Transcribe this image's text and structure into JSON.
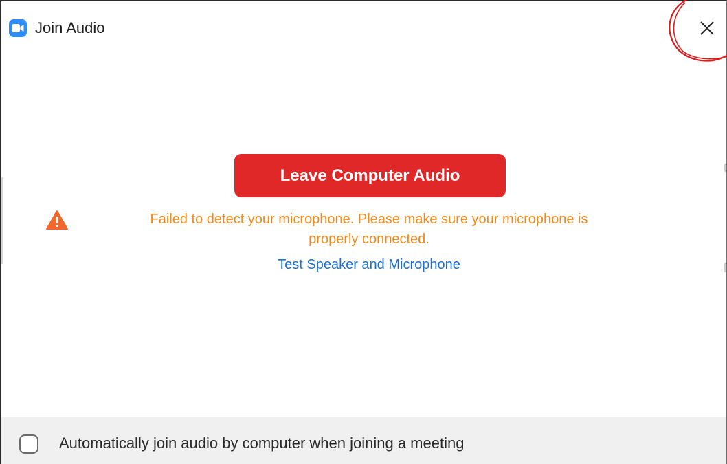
{
  "window": {
    "title": "Join Audio",
    "app_icon": "zoom-camera-icon",
    "close_icon": "close-icon"
  },
  "main": {
    "leave_button_label": "Leave Computer Audio",
    "warning_icon": "warning-triangle-icon",
    "warning_line1": "Failed to detect your microphone. Please make sure your microphone is",
    "warning_line2": "properly connected.",
    "test_link_label": "Test Speaker and Microphone"
  },
  "footer": {
    "auto_join_checked": false,
    "auto_join_label": "Automatically join audio by computer when joining a meeting"
  },
  "colors": {
    "accent_blue": "#2d8cff",
    "leave_button": "#e02828",
    "warning_text": "#f28a1a",
    "warning_icon": "#f0692a",
    "link": "#1a6fd6",
    "annotation_circle": "#d81e1e"
  }
}
